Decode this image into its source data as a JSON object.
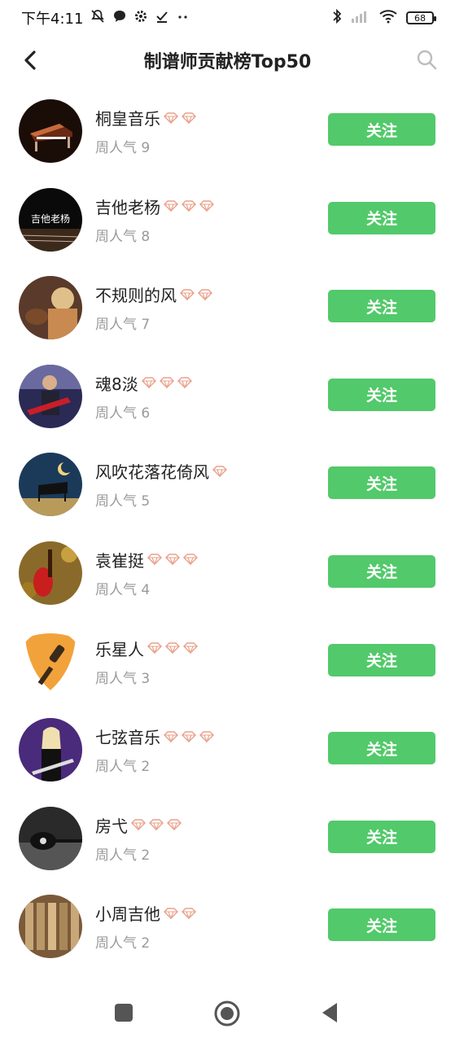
{
  "status_bar": {
    "time": "下午4:11",
    "battery": "68",
    "icons": [
      "mute-icon",
      "chat-bubble-icon",
      "gear-icon",
      "check-icon",
      "more-dots-icon",
      "bluetooth-icon",
      "signal-icon",
      "wifi-icon",
      "battery-icon"
    ]
  },
  "header": {
    "title": "制谱师贡献榜Top50",
    "back_icon": "back-arrow-icon",
    "search_icon": "search-icon"
  },
  "follow_label": "关注",
  "badge_color": "#e9a08a",
  "accent_color": "#52c96a",
  "creators": [
    {
      "name": "桐皇音乐",
      "popularity": "周人气 9",
      "badges": 2,
      "avatar": "grand-piano"
    },
    {
      "name": "吉他老杨",
      "popularity": "周人气 8",
      "badges": 3,
      "avatar": "guitar-text",
      "avatar_text": "吉他老杨"
    },
    {
      "name": "不规则的风",
      "popularity": "周人气 7",
      "badges": 2,
      "avatar": "girl-violin"
    },
    {
      "name": "魂8淡",
      "popularity": "周人气 6",
      "badges": 3,
      "avatar": "guitarist"
    },
    {
      "name": "风吹花落花倚风",
      "popularity": "周人气 5",
      "badges": 1,
      "avatar": "piano-moon"
    },
    {
      "name": "袁崔挺",
      "popularity": "周人气 4",
      "badges": 3,
      "avatar": "red-guitar"
    },
    {
      "name": "乐星人",
      "popularity": "周人气 3",
      "badges": 3,
      "avatar": "guitar-pick"
    },
    {
      "name": "七弦音乐",
      "popularity": "周人气 2",
      "badges": 3,
      "avatar": "woman-guitar"
    },
    {
      "name": "房弋",
      "popularity": "周人气 2",
      "badges": 3,
      "avatar": "dark-guitar"
    },
    {
      "name": "小周吉他",
      "popularity": "周人气 2",
      "badges": 2,
      "avatar": "sepia-keys"
    }
  ],
  "nav_bar": {
    "items": [
      "recent-apps-icon",
      "home-icon",
      "back-icon"
    ]
  }
}
